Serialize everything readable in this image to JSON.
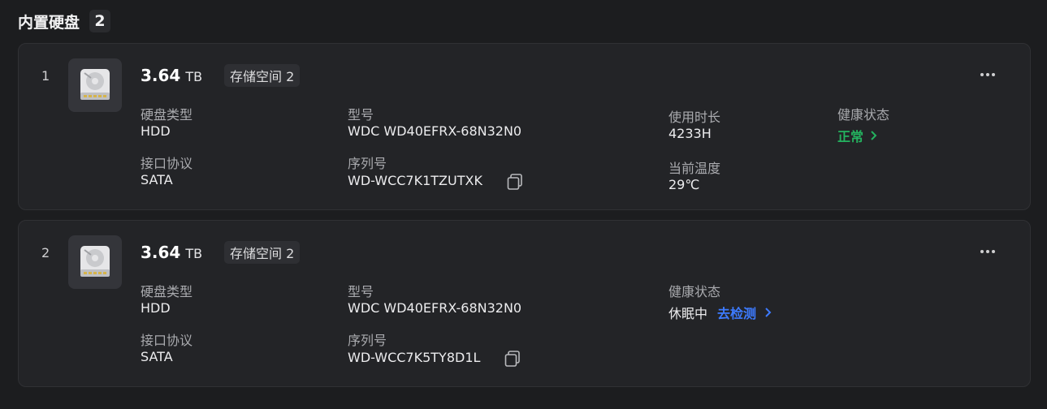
{
  "header": {
    "title": "内置硬盘",
    "count": "2"
  },
  "disks": [
    {
      "index": "1",
      "capacity_value": "3.64",
      "capacity_unit": "TB",
      "pool": "存储空间 2",
      "type_label": "硬盘类型",
      "type_value": "HDD",
      "interface_label": "接口协议",
      "interface_value": "SATA",
      "model_label": "型号",
      "model_value": "WDC WD40EFRX-68N32N0",
      "serial_label": "序列号",
      "serial_value": "WD-WCC7K1TZUTXK",
      "usage_label": "使用时长",
      "usage_value": "4233H",
      "temp_label": "当前温度",
      "temp_value": "29℃",
      "health_label": "健康状态",
      "health_value": "正常"
    },
    {
      "index": "2",
      "capacity_value": "3.64",
      "capacity_unit": "TB",
      "pool": "存储空间 2",
      "type_label": "硬盘类型",
      "type_value": "HDD",
      "interface_label": "接口协议",
      "interface_value": "SATA",
      "model_label": "型号",
      "model_value": "WDC WD40EFRX-68N32N0",
      "serial_label": "序列号",
      "serial_value": "WD-WCC7K5TY8D1L",
      "health_label": "健康状态",
      "health_state": "休眠中",
      "health_action": "去检测"
    }
  ],
  "colors": {
    "ok": "#24b25f",
    "link": "#3d7bff"
  },
  "icons": {
    "disk": "hard-disk-icon",
    "copy": "copy-icon",
    "more": "more-icon",
    "chevron": "chevron-right-icon"
  }
}
